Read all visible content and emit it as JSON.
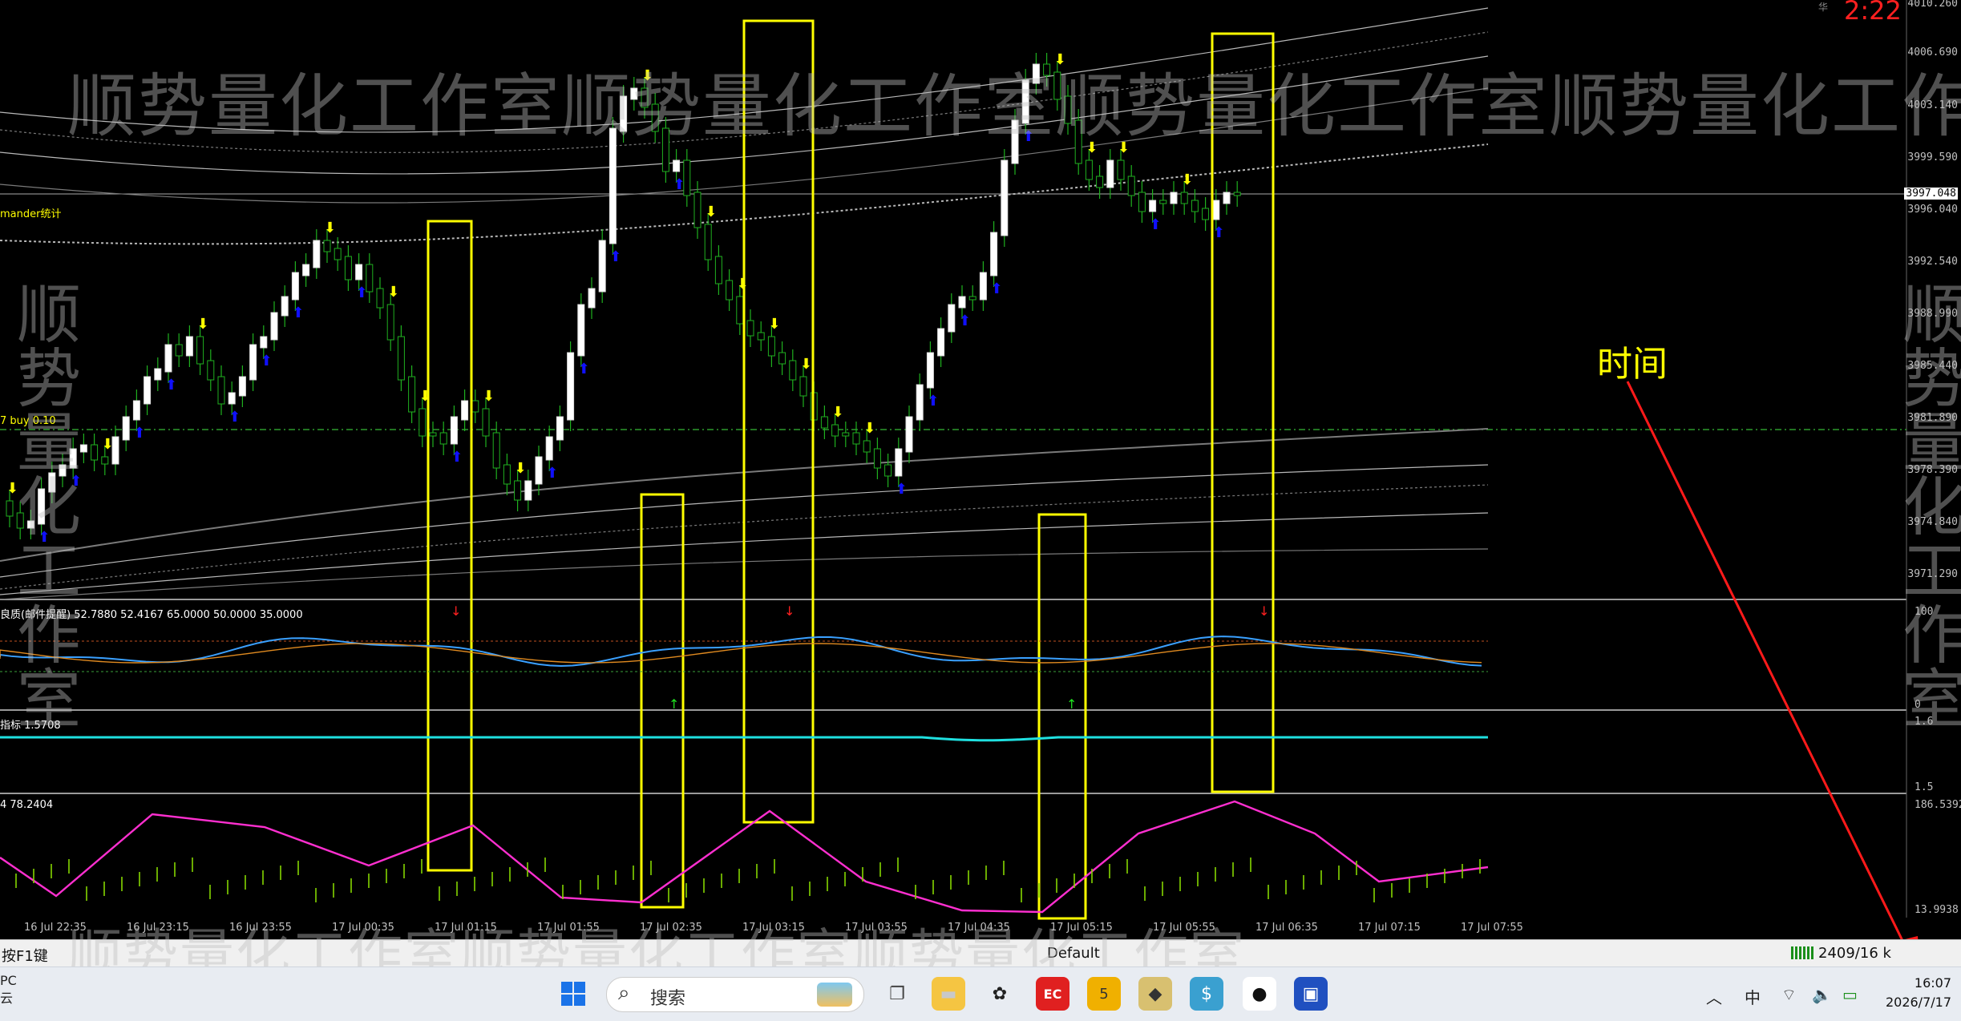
{
  "app": {
    "top_right_countdown": "2:22",
    "top_right_small": "华"
  },
  "watermark": {
    "text": "顺势量化工作室顺势量化工作室顺势量化工作室顺势量化工作室",
    "vertical_left": "顺势量化工作室",
    "vertical_right": "顺势量化工作室",
    "bottom": "顺势量化工作室顺势量化工作室顺势量化工作室"
  },
  "indicators": {
    "main_label": "mander统计",
    "order_line_label": "7 buy 0.10",
    "sub1_label": "良质(邮件提醒) 52.7880 52.4167 65.0000 50.0000 35.0000",
    "sub2_label": "指标 1.5708",
    "sub3_label": "4 78.2404"
  },
  "annotation": {
    "text": "时间"
  },
  "price_axis": {
    "labels": [
      "4010.260",
      "4006.690",
      "4003.140",
      "3999.590",
      "3997.048",
      "3996.040",
      "3992.540",
      "3988.990",
      "3985.440",
      "3981.890",
      "3978.390",
      "3974.840",
      "3971.290"
    ],
    "current": "3997.048",
    "sub1_top": "100",
    "sub1_bottom": "0",
    "sub2_top": "1.6",
    "sub2_bottom": "1.5",
    "sub3_top": "186.5392",
    "sub3_bottom": "13.9938"
  },
  "time_axis": [
    "16 Jul 22:35",
    "16 Jul 23:15",
    "16 Jul 23:55",
    "17 Jul 00:35",
    "17 Jul 01:15",
    "17 Jul 01:55",
    "17 Jul 02:35",
    "17 Jul 03:15",
    "17 Jul 03:55",
    "17 Jul 04:35",
    "17 Jul 05:15",
    "17 Jul 05:55",
    "17 Jul 06:35",
    "17 Jul 07:15",
    "17 Jul 07:55"
  ],
  "statusbar": {
    "help": "按F1键",
    "profile": "Default",
    "traffic": "2409/16 k"
  },
  "taskbar": {
    "search_placeholder": "搜索",
    "weather_top": "PC",
    "weather_bottom": "云",
    "ime": "中",
    "time": "16:07",
    "date": "2026/7/17"
  },
  "colors": {
    "bull": "#ffffff",
    "bear": "#1a8f1a",
    "box": "#ffff00",
    "buy_arrow": "#1010ff",
    "sell_arrow": "#ffff00",
    "pink": "#ff2fd0",
    "green": "#84d600",
    "cyan": "#1fe0e0"
  }
}
